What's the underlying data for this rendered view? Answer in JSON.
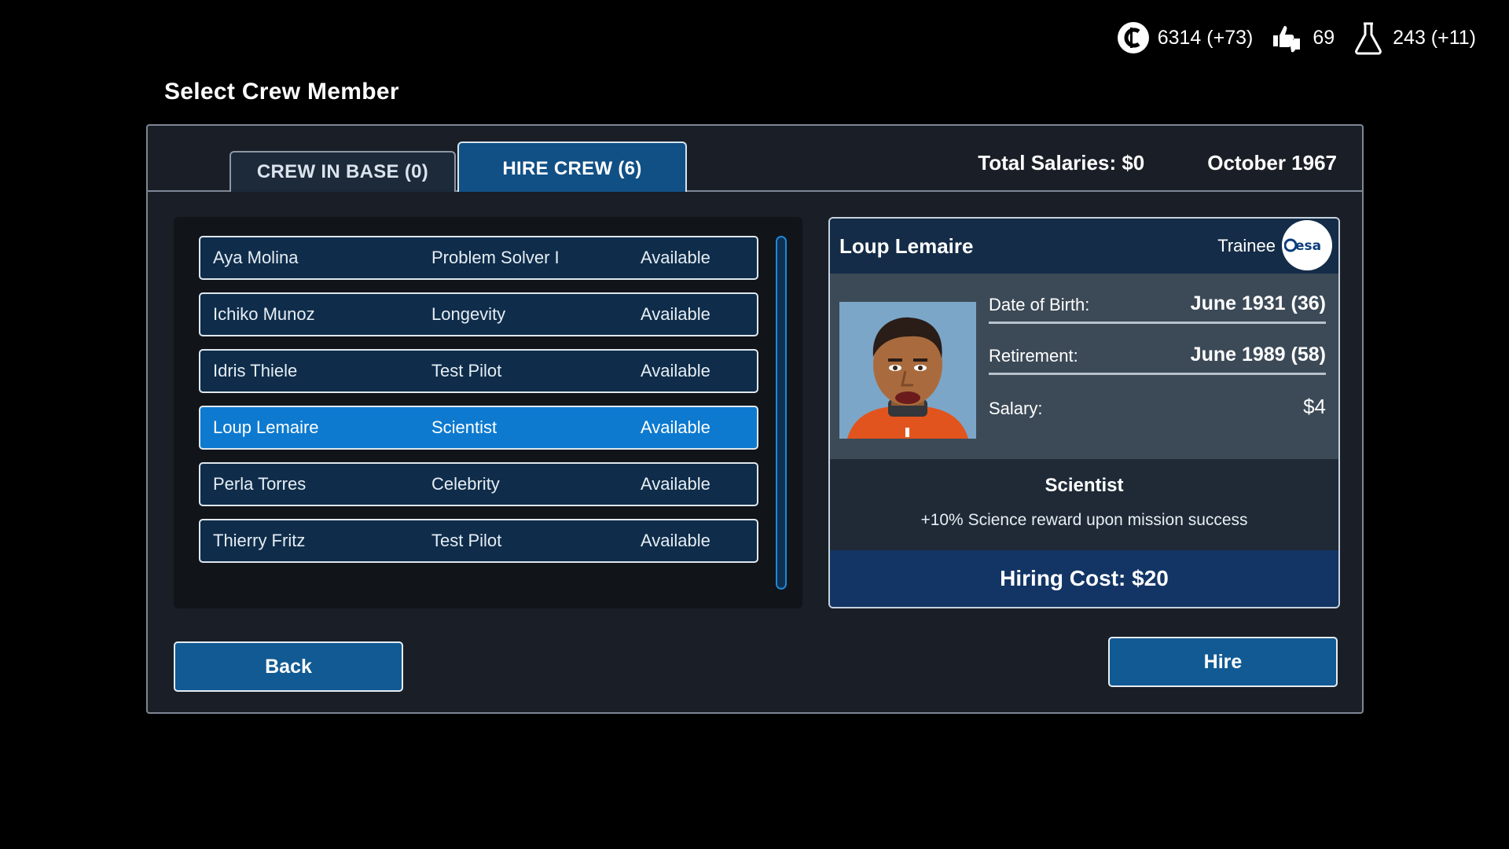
{
  "resources": {
    "credits": "6314 (+73)",
    "reputation": "69",
    "science": "243 (+11)",
    "icons": [
      "credits-icon",
      "reputation-icon",
      "science-icon"
    ]
  },
  "page_title": "Select Crew Member",
  "tabs": [
    {
      "label": "CREW IN BASE (0)",
      "active": false
    },
    {
      "label": "HIRE CREW (6)",
      "active": true
    }
  ],
  "header": {
    "total_salaries": "Total Salaries: $0",
    "date": "October 1967"
  },
  "crew_list": [
    {
      "name": "Aya Molina",
      "specialty": "Problem Solver I",
      "status": "Available",
      "selected": false
    },
    {
      "name": "Ichiko Munoz",
      "specialty": "Longevity",
      "status": "Available",
      "selected": false
    },
    {
      "name": "Idris Thiele",
      "specialty": "Test Pilot",
      "status": "Available",
      "selected": false
    },
    {
      "name": "Loup Lemaire",
      "specialty": "Scientist",
      "status": "Available",
      "selected": true
    },
    {
      "name": "Perla Torres",
      "specialty": "Celebrity",
      "status": "Available",
      "selected": false
    },
    {
      "name": "Thierry Fritz",
      "specialty": "Test Pilot",
      "status": "Available",
      "selected": false
    }
  ],
  "detail": {
    "name": "Loup Lemaire",
    "rank": "Trainee",
    "agency_logo_text": "esa",
    "dob_label": "Date of Birth:",
    "dob_value": "June 1931 (36)",
    "retirement_label": "Retirement:",
    "retirement_value": "June 1989 (58)",
    "salary_label": "Salary:",
    "salary_value": "$4",
    "specialty": "Scientist",
    "specialty_desc": "+10% Science reward upon mission success",
    "hiring_cost": "Hiring Cost: $20"
  },
  "buttons": {
    "back": "Back",
    "hire": "Hire"
  },
  "colors": {
    "accent_selected": "#0d7ad0",
    "tab_active": "#115085",
    "button": "#125a93",
    "cost_bar": "#133565"
  }
}
